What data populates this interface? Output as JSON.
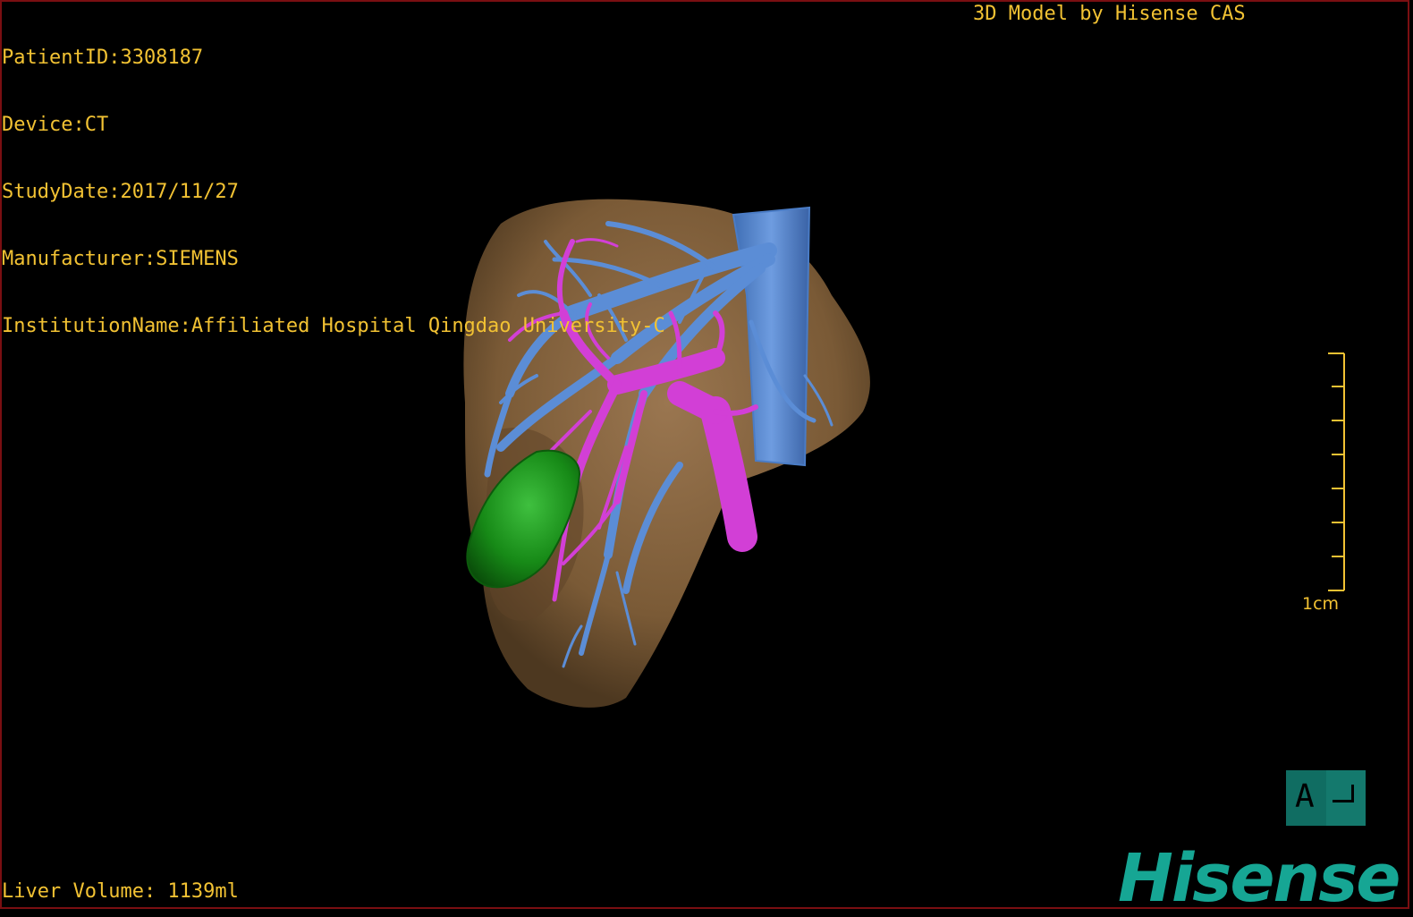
{
  "overlay": {
    "patient_id": "PatientID:3308187",
    "device": "Device:CT",
    "study_date": "StudyDate:2017/11/27",
    "manufacturer": "Manufacturer:SIEMENS",
    "institution": "InstitutionName:Affiliated Hospital Qingdao University-C",
    "model_credit": "3D Model by Hisense CAS",
    "liver_volume": "Liver Volume: 1139ml"
  },
  "scale_bar": {
    "label": "1cm"
  },
  "orientation": {
    "letter": "A"
  },
  "brand": {
    "logo_text": "Hisense"
  },
  "colors": {
    "text": "#f2c233",
    "liver": "#7a5a36",
    "hepatic_vein": "#5b8dd6",
    "portal_vein": "#d23fd6",
    "gallbladder": "#1a8a1a",
    "logo": "#16a694",
    "frame": "#7a0f12"
  }
}
